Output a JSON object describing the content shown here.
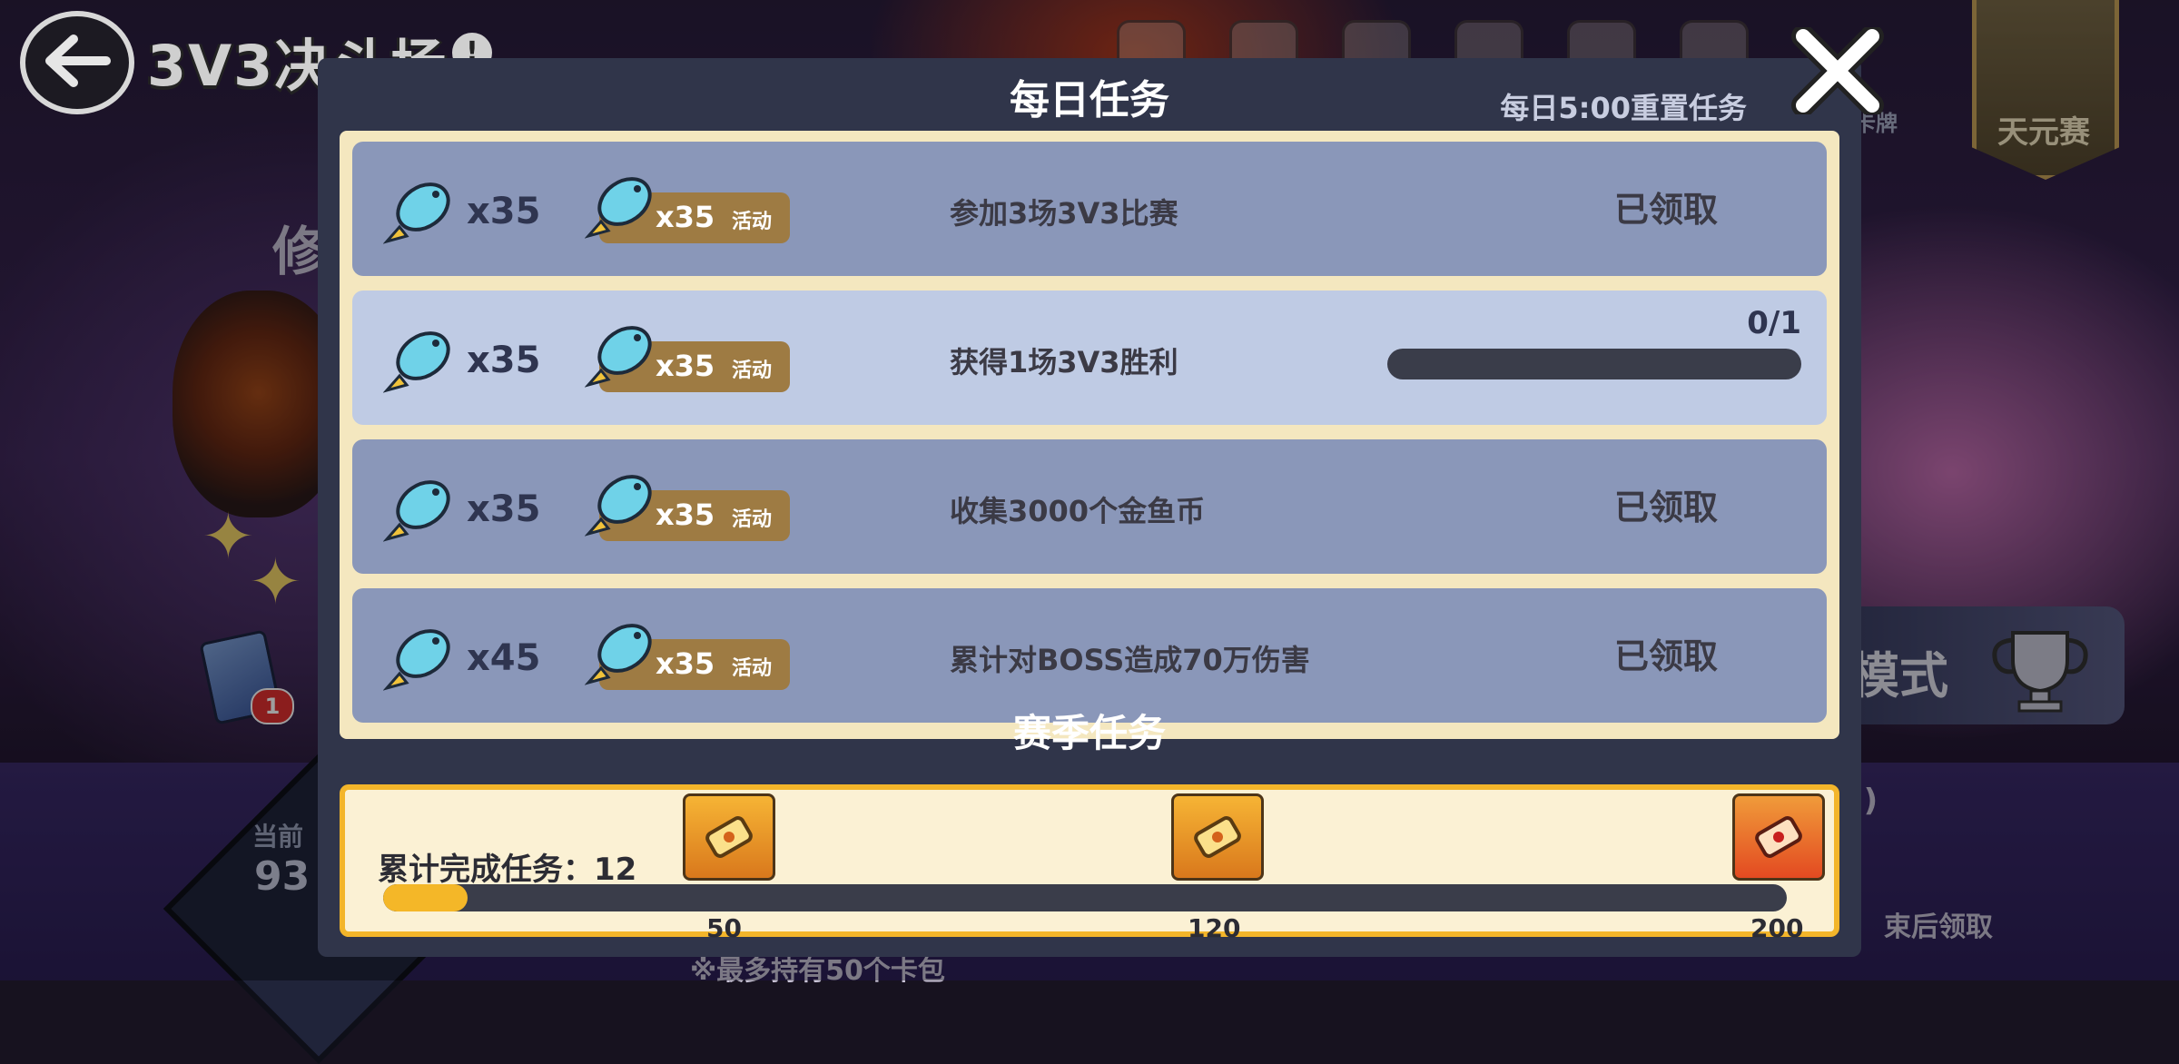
{
  "screen": {
    "title": "3V3决斗场"
  },
  "background": {
    "partial_text": "修",
    "card_badge_count": "1",
    "rank_label": "当前",
    "rank_value": "93",
    "bottom_note": "※最多持有50个卡包",
    "right_note": "束后领取",
    "right_paren": "J)",
    "mode_text": "模式",
    "card_label": "卡牌",
    "tianyuan_label": "天元赛"
  },
  "modal": {
    "title": "每日任务",
    "reset_note": "每日5:00重置任务",
    "tasks": [
      {
        "reward_qty": "x35",
        "event_qty": "x35",
        "event_tag": "活动",
        "desc": "参加3场3V3比赛",
        "status": "已领取"
      },
      {
        "reward_qty": "x35",
        "event_qty": "x35",
        "event_tag": "活动",
        "desc": "获得1场3V3胜利",
        "progress": "0/1",
        "progress_value": 0
      },
      {
        "reward_qty": "x35",
        "event_qty": "x35",
        "event_tag": "活动",
        "desc": "收集3000个金鱼币",
        "status": "已领取"
      },
      {
        "reward_qty": "x45",
        "event_qty": "x35",
        "event_tag": "活动",
        "desc": "累计对BOSS造成70万伤害",
        "status": "已领取"
      }
    ],
    "season": {
      "title": "赛季任务",
      "count_label": "累计完成任务：12",
      "completed": 12,
      "max": 200,
      "milestones": [
        "50",
        "120",
        "200"
      ]
    }
  },
  "colors": {
    "modal_bg": "#30354a",
    "row_bg": "#8a97b9",
    "row_highlight": "#bfcbe4",
    "event_pill": "#9e7b43",
    "progress_fill": "#f4b728",
    "panel_border": "#f3b52a"
  },
  "icons": [
    "back-arrow-icon",
    "info-icon",
    "close-icon",
    "fish-coin-icon",
    "reward-scroll-icon",
    "trophy-icon"
  ]
}
